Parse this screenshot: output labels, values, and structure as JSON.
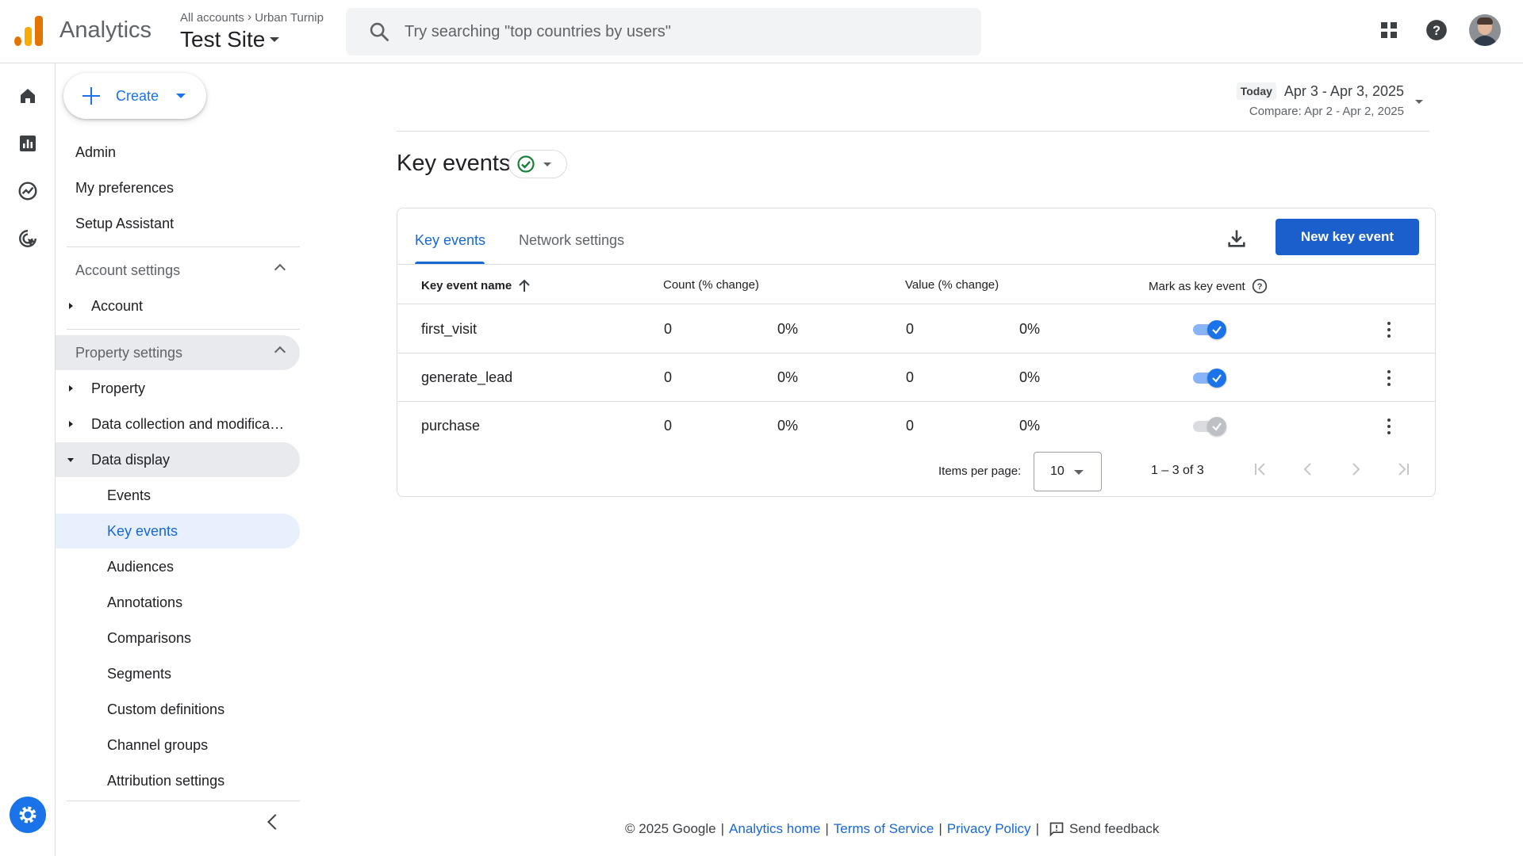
{
  "header": {
    "app_name": "Analytics",
    "breadcrumb": [
      "All accounts",
      "Urban Turnip"
    ],
    "property": "Test Site",
    "search_placeholder": "Try searching \"top countries by users\""
  },
  "sidebar": {
    "create_label": "Create",
    "top_items": [
      "Admin",
      "My preferences",
      "Setup Assistant"
    ],
    "account_section": "Account settings",
    "account_items": [
      "Account"
    ],
    "property_section": "Property settings",
    "property_items": [
      "Property",
      "Data collection and modifica…",
      "Data display"
    ],
    "data_display_items": [
      "Events",
      "Key events",
      "Audiences",
      "Annotations",
      "Comparisons",
      "Segments",
      "Custom definitions",
      "Channel groups",
      "Attribution settings"
    ]
  },
  "date": {
    "today": "Today",
    "range": "Apr 3 - Apr 3, 2025",
    "compare": "Compare: Apr 2 - Apr 2, 2025"
  },
  "page": {
    "title": "Key events",
    "tabs": [
      "Key events",
      "Network settings"
    ],
    "new_button": "New key event"
  },
  "table": {
    "headers": [
      "Key event name",
      "Count (% change)",
      "Value (% change)",
      "Mark as key event"
    ],
    "rows": [
      {
        "name": "first_visit",
        "count": "0",
        "count_change": "0%",
        "value": "0",
        "value_change": "0%",
        "key": true
      },
      {
        "name": "generate_lead",
        "count": "0",
        "count_change": "0%",
        "value": "0",
        "value_change": "0%",
        "key": true
      },
      {
        "name": "purchase",
        "count": "0",
        "count_change": "0%",
        "value": "0",
        "value_change": "0%",
        "key": false
      }
    ],
    "items_per_page_label": "Items per page:",
    "items_per_page": "10",
    "range": "1 – 3 of 3"
  },
  "footer": {
    "copyright": "© 2025 Google",
    "links": [
      "Analytics home",
      "Terms of Service",
      "Privacy Policy"
    ],
    "feedback": "Send feedback"
  },
  "colors": {
    "accent": "#1a73e8",
    "primary_button": "#1a5fcc",
    "selected_nav_bg": "#e8f0fe"
  }
}
